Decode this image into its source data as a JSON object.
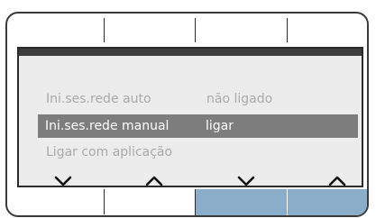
{
  "menu": {
    "rows": [
      {
        "name": "Ini.ses.rede auto",
        "value": "não ligado",
        "selected": false
      },
      {
        "name": "Ini.ses.rede manual",
        "value": "ligar",
        "selected": true
      },
      {
        "name": "Ligar com aplicação",
        "value": "",
        "selected": false
      }
    ]
  },
  "nav_arrows": [
    {
      "icon": "chevron-down-icon"
    },
    {
      "icon": "chevron-up-icon"
    },
    {
      "icon": "chevron-down-icon"
    },
    {
      "icon": "chevron-up-icon"
    }
  ],
  "colors": {
    "selection_bg": "#7d7d7d",
    "screen_bg": "#ececec",
    "active_softkey": "#8aaeca",
    "dim_text": "#a9a9a9"
  }
}
